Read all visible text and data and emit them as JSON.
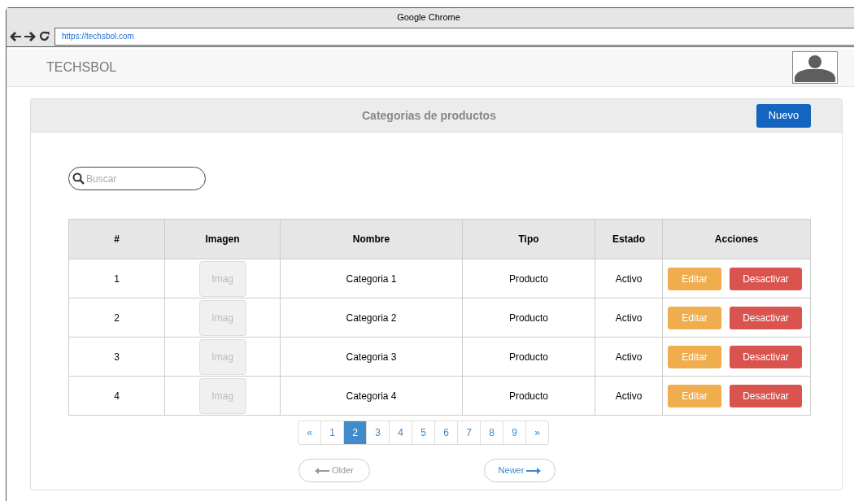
{
  "window": {
    "title": "Google Chrome",
    "url": "https://techsbol.com"
  },
  "header": {
    "brand": "TECHSBOL"
  },
  "panel": {
    "title": "Categorias de productos",
    "new_button": "Nuevo"
  },
  "search": {
    "placeholder": "Buscar"
  },
  "table": {
    "columns": [
      "#",
      "Imagen",
      "Nombre",
      "Tipo",
      "Estado",
      "Acciones"
    ],
    "rows": [
      {
        "index": "1",
        "image": "Imag",
        "name": "Categoria 1",
        "type": "Producto",
        "status": "Activo",
        "edit": "Editar",
        "deactivate": "Desactivar"
      },
      {
        "index": "2",
        "image": "Imag",
        "name": "Categoria 2",
        "type": "Producto",
        "status": "Activo",
        "edit": "Editar",
        "deactivate": "Desactivar"
      },
      {
        "index": "3",
        "image": "Imag",
        "name": "Categoria 3",
        "type": "Producto",
        "status": "Activo",
        "edit": "Editar",
        "deactivate": "Desactivar"
      },
      {
        "index": "4",
        "image": "Imag",
        "name": "Categoria 4",
        "type": "Producto",
        "status": "Activo",
        "edit": "Editar",
        "deactivate": "Desactivar"
      }
    ]
  },
  "pagination": [
    {
      "label": "«",
      "selected": false
    },
    {
      "label": "1",
      "selected": false
    },
    {
      "label": "2",
      "selected": true
    },
    {
      "label": "3",
      "selected": false
    },
    {
      "label": "4",
      "selected": false
    },
    {
      "label": "5",
      "selected": false
    },
    {
      "label": "6",
      "selected": false
    },
    {
      "label": "7",
      "selected": false
    },
    {
      "label": "8",
      "selected": false
    },
    {
      "label": "9",
      "selected": false
    },
    {
      "label": "»",
      "selected": false
    }
  ],
  "pager": [
    {
      "kind": "prev",
      "label": "Older",
      "disabled": true
    },
    {
      "kind": "next",
      "label": "Newer",
      "disabled": false
    }
  ]
}
